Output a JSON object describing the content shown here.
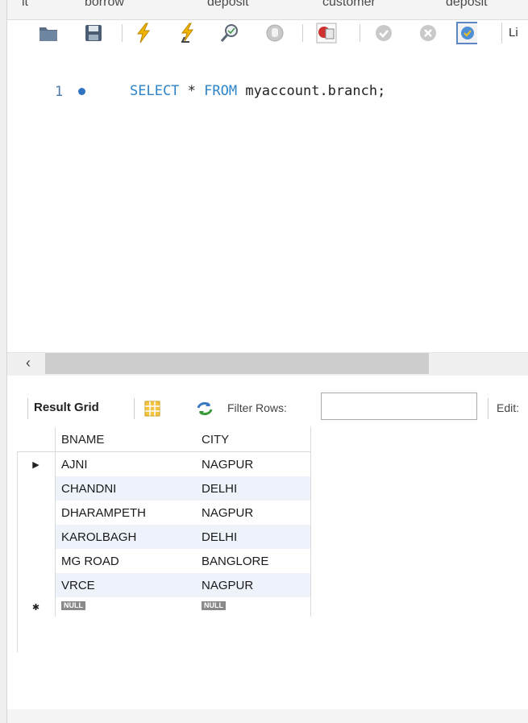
{
  "tabs": [
    "it",
    "borrow",
    "deposit",
    "customer",
    "deposit"
  ],
  "toolbar": {
    "limit_label": "Li"
  },
  "editor": {
    "line_number": "1",
    "code_keyword_1": "SELECT",
    "code_star": " * ",
    "code_keyword_2": "FROM",
    "code_rest": " myaccount.branch;"
  },
  "results": {
    "result_grid_label": "Result Grid",
    "filter_label": "Filter Rows:",
    "filter_value": "",
    "edit_label": "Edit:",
    "columns": [
      "BNAME",
      "CITY"
    ],
    "rows": [
      [
        "AJNI",
        "NAGPUR"
      ],
      [
        "CHANDNI",
        "DELHI"
      ],
      [
        "DHARAMPETH",
        "NAGPUR"
      ],
      [
        "KAROLBAGH",
        "DELHI"
      ],
      [
        "MG ROAD",
        "BANGLORE"
      ],
      [
        "VRCE",
        "NAGPUR"
      ]
    ],
    "null_label": "NULL",
    "current_row_marker": "▶",
    "new_row_marker": "✱"
  },
  "colors": {
    "keyword": "#2e84c9",
    "alt_row": "#eef3fb"
  }
}
